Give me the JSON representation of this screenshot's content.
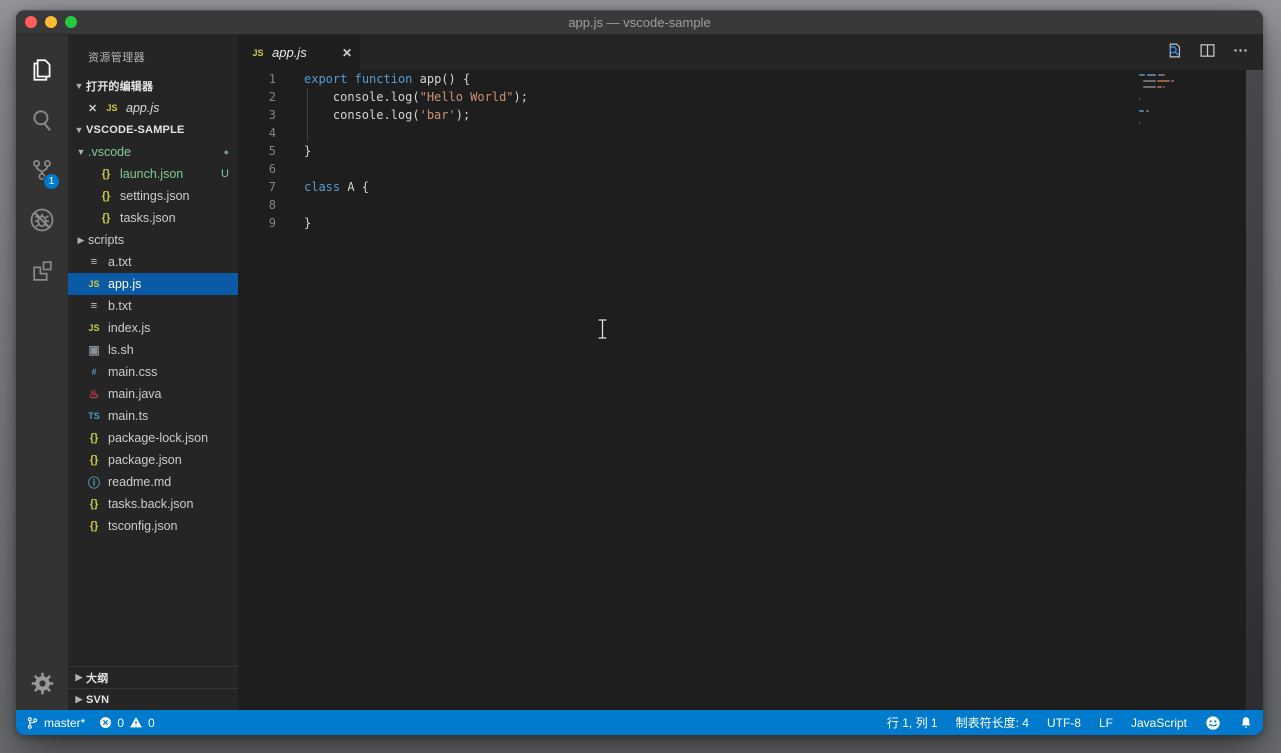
{
  "window": {
    "title": "app.js — vscode-sample"
  },
  "activity_bar": {
    "items": [
      {
        "name": "explorer",
        "active": true
      },
      {
        "name": "search"
      },
      {
        "name": "source-control",
        "badge": "1"
      },
      {
        "name": "debug"
      },
      {
        "name": "extensions"
      }
    ],
    "settings_icon": "gear"
  },
  "sidebar": {
    "title": "资源管理器",
    "open_editors": {
      "label": "打开的编辑器",
      "items": [
        {
          "label": "app.js",
          "icon": "js"
        }
      ]
    },
    "workspace": {
      "label": "VSCODE-SAMPLE",
      "tree": [
        {
          "name": ".vscode",
          "icon": "folder",
          "arrow": "expanded",
          "indent": 0,
          "color": "#81c995",
          "badge": "dot"
        },
        {
          "name": "launch.json",
          "icon": "json",
          "indent": 1,
          "color": "#81c995",
          "badge": "U"
        },
        {
          "name": "settings.json",
          "icon": "json",
          "indent": 1
        },
        {
          "name": "tasks.json",
          "icon": "json",
          "indent": 1
        },
        {
          "name": "scripts",
          "icon": "folder",
          "arrow": "collapsed",
          "indent": 0
        },
        {
          "name": "a.txt",
          "icon": "txt",
          "indent": 0.5
        },
        {
          "name": "app.js",
          "icon": "js",
          "indent": 0.5,
          "selected": true
        },
        {
          "name": "b.txt",
          "icon": "txt",
          "indent": 0.5
        },
        {
          "name": "index.js",
          "icon": "js",
          "indent": 0.5
        },
        {
          "name": "ls.sh",
          "icon": "shell",
          "indent": 0.5
        },
        {
          "name": "main.css",
          "icon": "css",
          "indent": 0.5
        },
        {
          "name": "main.java",
          "icon": "java",
          "indent": 0.5
        },
        {
          "name": "main.ts",
          "icon": "ts",
          "indent": 0.5
        },
        {
          "name": "package-lock.json",
          "icon": "json",
          "indent": 0.5
        },
        {
          "name": "package.json",
          "icon": "json",
          "indent": 0.5
        },
        {
          "name": "readme.md",
          "icon": "info",
          "indent": 0.5
        },
        {
          "name": "tasks.back.json",
          "icon": "json",
          "indent": 0.5
        },
        {
          "name": "tsconfig.json",
          "icon": "json",
          "indent": 0.5
        }
      ]
    },
    "bottom_sections": [
      {
        "label": "大纲"
      },
      {
        "label": "SVN"
      }
    ]
  },
  "editor": {
    "tab": {
      "label": "app.js",
      "icon": "js",
      "close": "✕"
    },
    "actions": [
      "open-changes",
      "split-editor",
      "more-actions"
    ],
    "lines": [
      {
        "num": "1",
        "tokens": [
          [
            "kw",
            "export"
          ],
          [
            "pl",
            " "
          ],
          [
            "kw",
            "function"
          ],
          [
            "pl",
            " app() {"
          ]
        ]
      },
      {
        "num": "2",
        "tokens": [
          [
            "pl",
            "    console.log("
          ],
          [
            "str",
            "\"Hello World\""
          ],
          [
            "pl",
            ");"
          ]
        ]
      },
      {
        "num": "3",
        "tokens": [
          [
            "pl",
            "    console.log("
          ],
          [
            "str",
            "'bar'"
          ],
          [
            "pl",
            ");"
          ]
        ]
      },
      {
        "num": "4",
        "tokens": []
      },
      {
        "num": "5",
        "tokens": [
          [
            "pl",
            "}"
          ]
        ]
      },
      {
        "num": "6",
        "tokens": []
      },
      {
        "num": "7",
        "tokens": [
          [
            "kw",
            "class"
          ],
          [
            "pl",
            " A {"
          ]
        ]
      },
      {
        "num": "8",
        "tokens": []
      },
      {
        "num": "9",
        "tokens": [
          [
            "pl",
            "}"
          ]
        ]
      }
    ]
  },
  "status_bar": {
    "branch": "master*",
    "errors": "0",
    "warnings": "0",
    "line_col": "行 1, 列 1",
    "tab_size": "制表符长度: 4",
    "encoding": "UTF-8",
    "eol": "LF",
    "language": "JavaScript"
  },
  "colors": {
    "accent": "#007acc",
    "selection": "#0b5aa6",
    "git_added": "#81c995",
    "keyword": "#569cd6",
    "string": "#ce9178",
    "plain": "#d4d4d4"
  }
}
